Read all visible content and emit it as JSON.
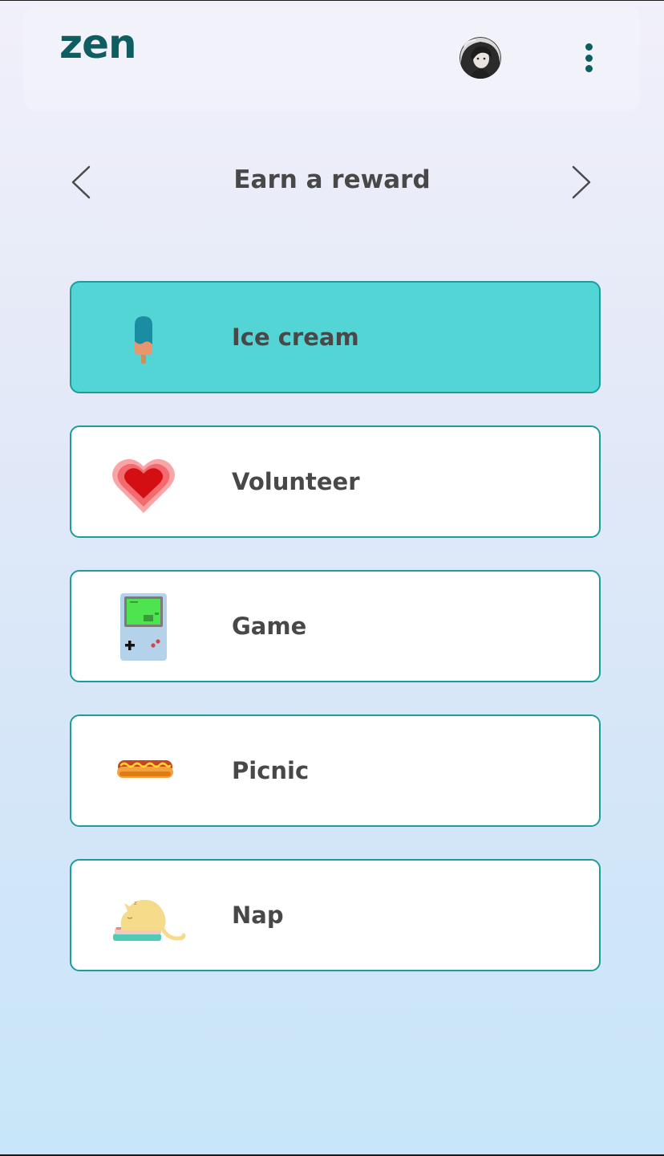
{
  "app": {
    "logo": "zen"
  },
  "header": {
    "avatar_alt": "User avatar"
  },
  "page": {
    "title": "Earn a reward"
  },
  "rewards": [
    {
      "label": "Ice cream",
      "icon": "ice-cream-icon",
      "selected": true
    },
    {
      "label": "Volunteer",
      "icon": "heart-icon",
      "selected": false
    },
    {
      "label": "Game",
      "icon": "game-console-icon",
      "selected": false
    },
    {
      "label": "Picnic",
      "icon": "hotdog-icon",
      "selected": false
    },
    {
      "label": "Nap",
      "icon": "sleeping-cat-icon",
      "selected": false
    }
  ],
  "colors": {
    "brand": "#0e5d60",
    "accent": "#53d5d6",
    "border": "#1d9d9a",
    "text": "#484848"
  }
}
